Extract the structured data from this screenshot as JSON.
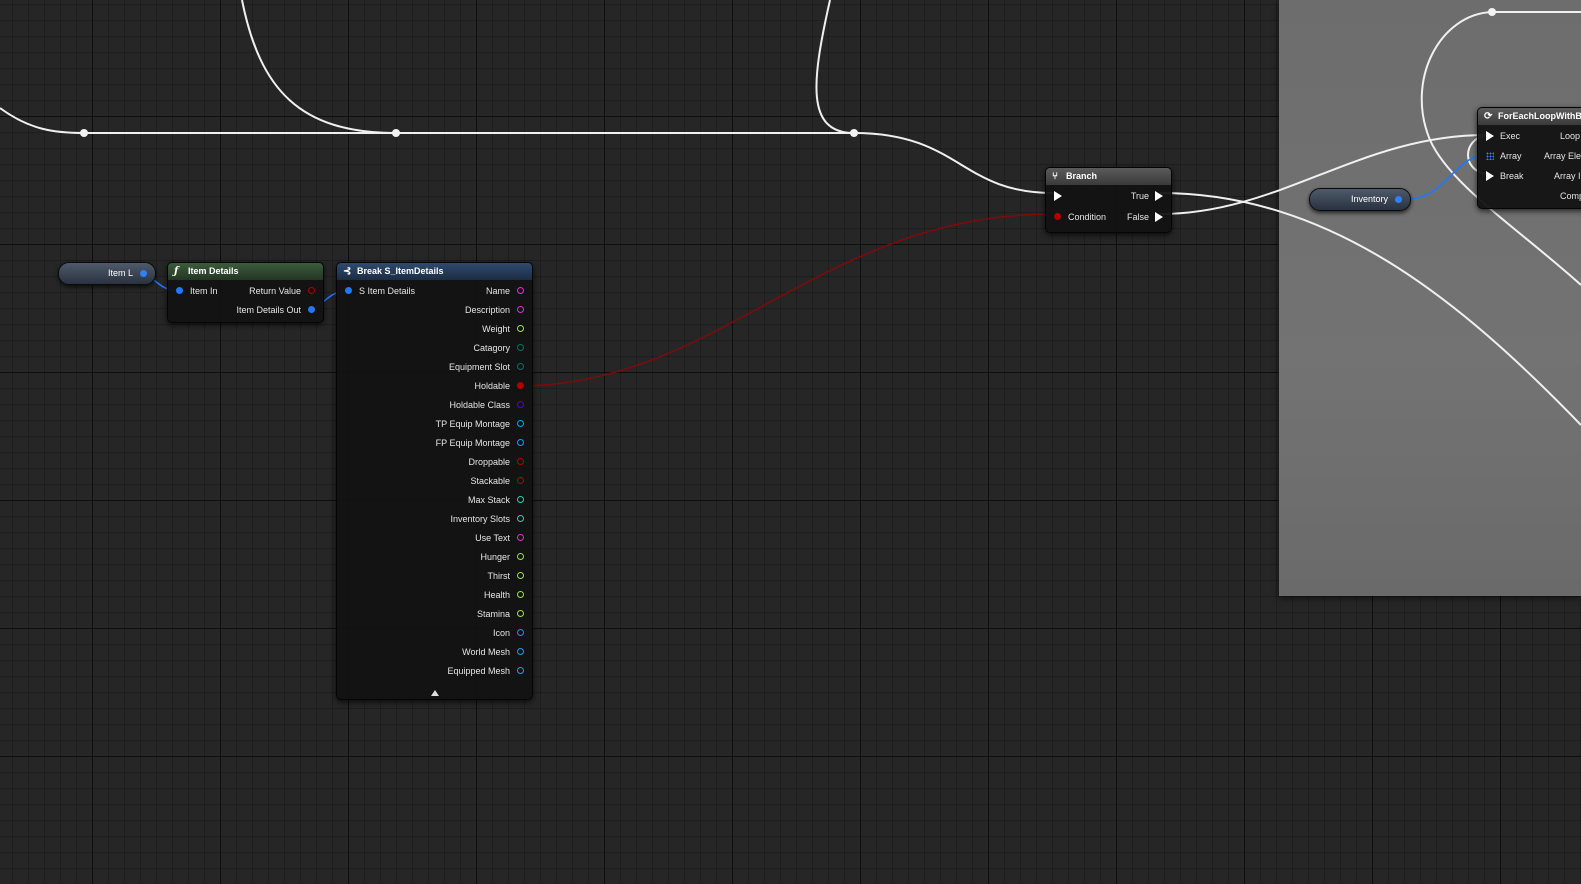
{
  "graph": {
    "colors": {
      "exec": "#ffffff",
      "struct": "#1f78ff",
      "string": "#e22fd2",
      "float": "#9be054",
      "byte": "#0f6f68",
      "bool": "#b20000",
      "class": "#5a00d4",
      "object": "#0aa7e8",
      "integer": "#1ed8a7",
      "texture": "#00a0e6"
    }
  },
  "var_item": {
    "label": "Item L"
  },
  "var_inventory": {
    "label": "Inventory"
  },
  "node_item_details": {
    "title": "Item Details",
    "icon": "function-icon",
    "inputs": [
      "Item In"
    ],
    "outputs": [
      "Return Value",
      "Item Details Out"
    ]
  },
  "node_break": {
    "title": "Break S_ItemDetails",
    "icon": "break-struct-icon",
    "input": "S Item Details",
    "outputs": [
      "Name",
      "Description",
      "Weight",
      "Catagory",
      "Equipment Slot",
      "Holdable",
      "Holdable Class",
      "TP Equip Montage",
      "FP Equip Montage",
      "Droppable",
      "Stackable",
      "Max Stack",
      "Inventory Slots",
      "Use Text",
      "Hunger",
      "Thirst",
      "Health",
      "Stamina",
      "Icon",
      "World Mesh",
      "Equipped Mesh"
    ]
  },
  "node_branch": {
    "title": "Branch",
    "icon": "branch-icon",
    "condition": "Condition",
    "true_label": "True",
    "false_label": "False"
  },
  "node_foreach": {
    "title": "ForEachLoopWithBre",
    "icon": "loop-icon",
    "inputs": [
      "Exec",
      "Array",
      "Break"
    ],
    "outputs": [
      "Loop",
      "Array Elem",
      "Array In",
      "Comp"
    ]
  }
}
